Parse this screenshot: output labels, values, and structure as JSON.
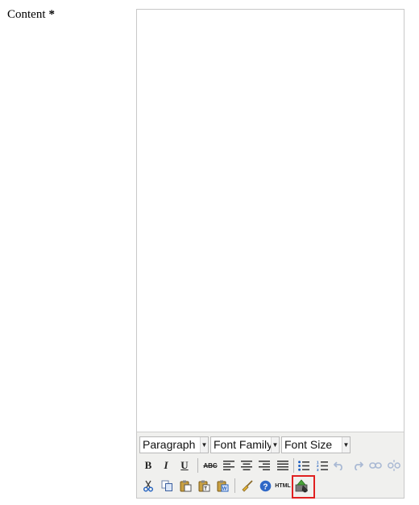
{
  "field": {
    "label": "Content",
    "required_mark": "*"
  },
  "toolbar": {
    "format_select": {
      "value": "Paragraph"
    },
    "font_family_select": {
      "value": "Font Family"
    },
    "font_size_select": {
      "value": "Font Size"
    },
    "bold_label": "B",
    "italic_label": "I",
    "underline_label": "U",
    "strikethrough_label": "ABC",
    "html_label": "HTML"
  },
  "colors": {
    "highlight": "#e02020",
    "toolbar_bg": "#f0f0ee",
    "icon_blue": "#1f5fbf",
    "disabled": "#a9b9d4"
  }
}
